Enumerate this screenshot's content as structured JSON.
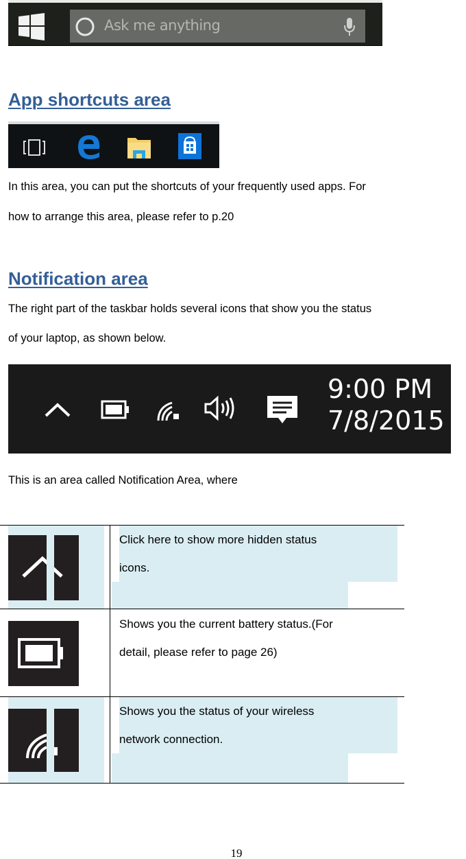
{
  "search_bar": {
    "placeholder": "Ask me anything",
    "icons": [
      "windows-logo-icon",
      "cortana-circle-icon",
      "microphone-icon"
    ]
  },
  "app_shortcuts": {
    "heading": "App shortcuts area",
    "icons": [
      "task-view-icon",
      "edge-browser-icon",
      "file-explorer-icon",
      "store-icon"
    ],
    "para_line1": "In this area, you can put the shortcuts of your frequently used apps. For",
    "para_line2": "how to arrange this area, please refer to p.20"
  },
  "notification": {
    "heading": "Notification area",
    "para_line1": "The right part of the taskbar holds several icons that show you the status",
    "para_line2": "of your laptop, as shown below.",
    "time": "9:00 PM",
    "date": "7/8/2015",
    "icons": [
      "chevron-up-icon",
      "battery-icon",
      "wifi-icon",
      "volume-icon",
      "action-center-icon"
    ],
    "caption": "This is an area called Notification Area, where"
  },
  "table": {
    "rows": [
      {
        "icon": "chevron-up-icon",
        "line1": "Click here to show more hidden status",
        "line2": "icons."
      },
      {
        "icon": "battery-icon",
        "line1": "Shows you the current battery status.(For",
        "line2": "detail, please refer to page 26)"
      },
      {
        "icon": "wifi-icon",
        "line1": "Shows you the status of your wireless",
        "line2": "network connection."
      }
    ]
  },
  "page_number": "19",
  "colors": {
    "heading": "#335f96",
    "highlight": "#daedf3",
    "taskbar": "#1a1a1a"
  }
}
